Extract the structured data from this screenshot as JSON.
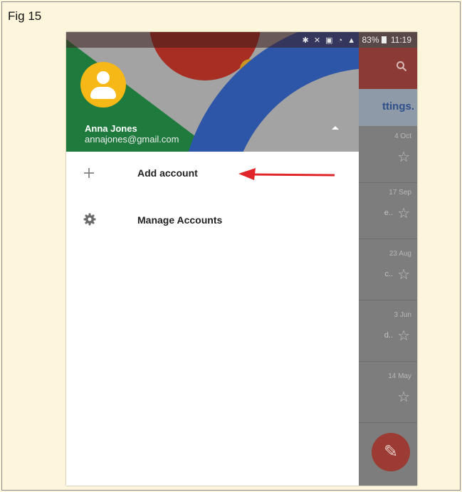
{
  "figure": {
    "label": "Fig 15"
  },
  "status_bar": {
    "icons": "✱ ✕ ▣ ◔ ▲",
    "battery": "83%",
    "time": "11:19"
  },
  "background": {
    "search_icon": "search-icon",
    "settings_text": "ttings.",
    "rows": [
      {
        "date": "4 Oct",
        "snippet": ""
      },
      {
        "date": "17 Sep",
        "snippet": "e.."
      },
      {
        "date": "23 Aug",
        "snippet": "c.."
      },
      {
        "date": "3 Jun",
        "snippet": "d.."
      },
      {
        "date": "14 May",
        "snippet": ""
      }
    ],
    "compose_icon": "pencil-icon"
  },
  "drawer": {
    "account": {
      "name": "Anna Jones",
      "email": "annajones@gmail.com"
    },
    "menu": [
      {
        "icon": "plus-icon",
        "label": "Add account"
      },
      {
        "icon": "gear-icon",
        "label": "Manage Accounts"
      }
    ]
  },
  "annotation": {
    "arrow_color": "#e0262b"
  },
  "colors": {
    "background": "#fdf6dc",
    "avatar": "#f6b816",
    "header_green": "#1f7a3d",
    "header_red": "#a82d22",
    "header_blue": "#2d55a8"
  }
}
